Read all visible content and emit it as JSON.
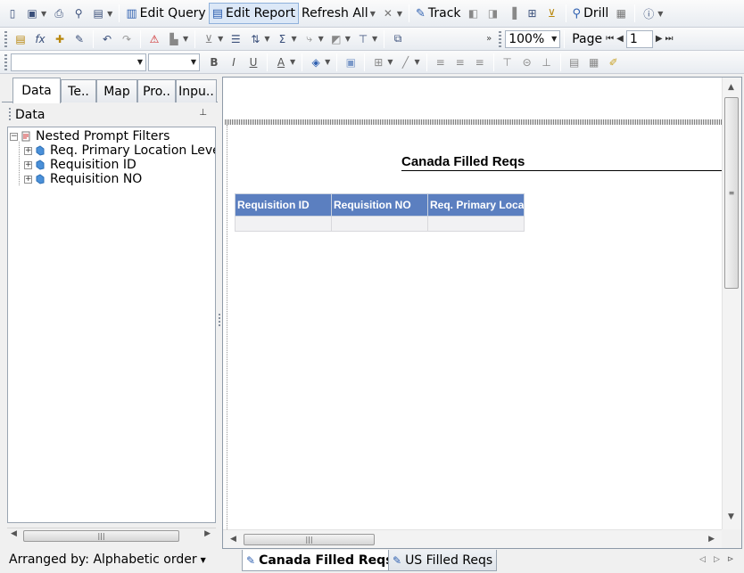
{
  "toolbar1": {
    "edit_query": "Edit Query",
    "edit_report": "Edit Report",
    "refresh_all": "Refresh All",
    "track": "Track",
    "drill": "Drill"
  },
  "toolbar2": {
    "zoom": "100%",
    "page_label": "Page",
    "page_value": "1"
  },
  "toolbar3": {
    "font_name": "",
    "font_size": "",
    "bold": "B",
    "italic": "I",
    "underline": "U",
    "font_color": "A"
  },
  "left_panel": {
    "tabs": [
      "Data",
      "Te..",
      "Map",
      "Pro..",
      "Inpu.."
    ],
    "active_tab": "Data",
    "header": "Data",
    "tree": {
      "root": "Nested Prompt Filters",
      "children": [
        "Req. Primary Location Leve",
        "Requisition ID",
        "Requisition NO"
      ]
    },
    "arranged_by": "Arranged by: Alphabetic order"
  },
  "report": {
    "title": "Canada Filled Reqs",
    "columns": [
      "Requisition ID",
      "Requisition NO",
      "Req. Primary Locat"
    ]
  },
  "bottom_tabs": [
    "Canada Filled Reqs",
    "US Filled Reqs"
  ],
  "colors": {
    "table_header": "#5b7fc0",
    "accent": "#2d5fb0"
  }
}
